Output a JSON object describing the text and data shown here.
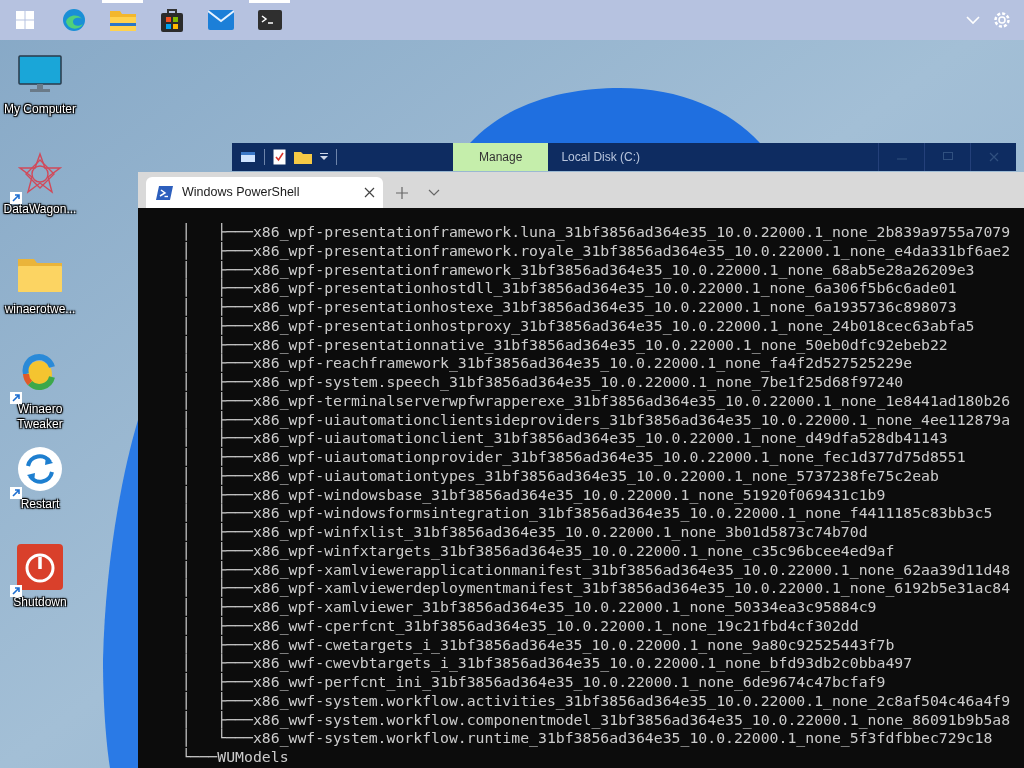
{
  "taskbar": {
    "apps": [
      {
        "kind": "start",
        "running": false
      },
      {
        "kind": "browser",
        "running": false
      },
      {
        "kind": "folder",
        "running": true
      },
      {
        "kind": "store",
        "running": false
      },
      {
        "kind": "mail",
        "running": false
      },
      {
        "kind": "terminal",
        "running": true
      }
    ]
  },
  "desktop_icons": [
    {
      "label": "My Computer",
      "kind": "computer",
      "shortcut": false
    },
    {
      "label": "DataWagon...",
      "kind": "star",
      "shortcut": true
    },
    {
      "label": "winaerotwe...",
      "kind": "folder",
      "shortcut": false
    },
    {
      "label": "Winaero Tweaker",
      "kind": "swirl",
      "shortcut": true
    },
    {
      "label": "Restart",
      "kind": "restart",
      "shortcut": true
    },
    {
      "label": "Shutdown",
      "kind": "power",
      "shortcut": true
    }
  ],
  "explorer": {
    "context_tab": "Manage",
    "title": "Local Disk (C:)"
  },
  "terminal": {
    "tab_title": "Windows PowerShell",
    "lines": [
      "    │   ├───x86_wpf-presentationframework.luna_31bf3856ad364e35_10.0.22000.1_none_2b839a9755a7079",
      "    │   ├───x86_wpf-presentationframework.royale_31bf3856ad364e35_10.0.22000.1_none_e4da331bf6ae2",
      "    │   ├───x86_wpf-presentationframework_31bf3856ad364e35_10.0.22000.1_none_68ab5e28a26209e3",
      "    │   ├───x86_wpf-presentationhostdll_31bf3856ad364e35_10.0.22000.1_none_6a306f5b6c6ade01",
      "    │   ├───x86_wpf-presentationhostexe_31bf3856ad364e35_10.0.22000.1_none_6a1935736c898073",
      "    │   ├───x86_wpf-presentationhostproxy_31bf3856ad364e35_10.0.22000.1_none_24b018cec63abfa5",
      "    │   ├───x86_wpf-presentationnative_31bf3856ad364e35_10.0.22000.1_none_50eb0dfc92ebeb22",
      "    │   ├───x86_wpf-reachframework_31bf3856ad364e35_10.0.22000.1_none_fa4f2d527525229e",
      "    │   ├───x86_wpf-system.speech_31bf3856ad364e35_10.0.22000.1_none_7be1f25d68f97240",
      "    │   ├───x86_wpf-terminalserverwpfwrapperexe_31bf3856ad364e35_10.0.22000.1_none_1e8441ad180b26",
      "    │   ├───x86_wpf-uiautomationclientsideproviders_31bf3856ad364e35_10.0.22000.1_none_4ee112879a",
      "    │   ├───x86_wpf-uiautomationclient_31bf3856ad364e35_10.0.22000.1_none_d49dfa528db41143",
      "    │   ├───x86_wpf-uiautomationprovider_31bf3856ad364e35_10.0.22000.1_none_fec1d377d75d8551",
      "    │   ├───x86_wpf-uiautomationtypes_31bf3856ad364e35_10.0.22000.1_none_5737238fe75c2eab",
      "    │   ├───x86_wpf-windowsbase_31bf3856ad364e35_10.0.22000.1_none_51920f069431c1b9",
      "    │   ├───x86_wpf-windowsformsintegration_31bf3856ad364e35_10.0.22000.1_none_f4411185c83bb3c5",
      "    │   ├───x86_wpf-winfxlist_31bf3856ad364e35_10.0.22000.1_none_3b01d5873c74b70d",
      "    │   ├───x86_wpf-winfxtargets_31bf3856ad364e35_10.0.22000.1_none_c35c96bcee4ed9af",
      "    │   ├───x86_wpf-xamlviewerapplicationmanifest_31bf3856ad364e35_10.0.22000.1_none_62aa39d11d48",
      "    │   ├───x86_wpf-xamlviewerdeploymentmanifest_31bf3856ad364e35_10.0.22000.1_none_6192b5e31ac84",
      "    │   ├───x86_wpf-xamlviewer_31bf3856ad364e35_10.0.22000.1_none_50334ea3c95884c9",
      "    │   ├───x86_wwf-cperfcnt_31bf3856ad364e35_10.0.22000.1_none_19c21fbd4cf302dd",
      "    │   ├───x86_wwf-cwetargets_i_31bf3856ad364e35_10.0.22000.1_none_9a80c92525443f7b",
      "    │   ├───x86_wwf-cwevbtargets_i_31bf3856ad364e35_10.0.22000.1_none_bfd93db2c0bba497",
      "    │   ├───x86_wwf-perfcnt_ini_31bf3856ad364e35_10.0.22000.1_none_6de9674c47bcfaf9",
      "    │   ├───x86_wwf-system.workflow.activities_31bf3856ad364e35_10.0.22000.1_none_2c8af504c46a4f9",
      "    │   ├───x86_wwf-system.workflow.componentmodel_31bf3856ad364e35_10.0.22000.1_none_86091b9b5a8",
      "    │   └───x86_wwf-system.workflow.runtime_31bf3856ad364e35_10.0.22000.1_none_5f3fdfbbec729c18",
      "    └───WUModels"
    ]
  }
}
